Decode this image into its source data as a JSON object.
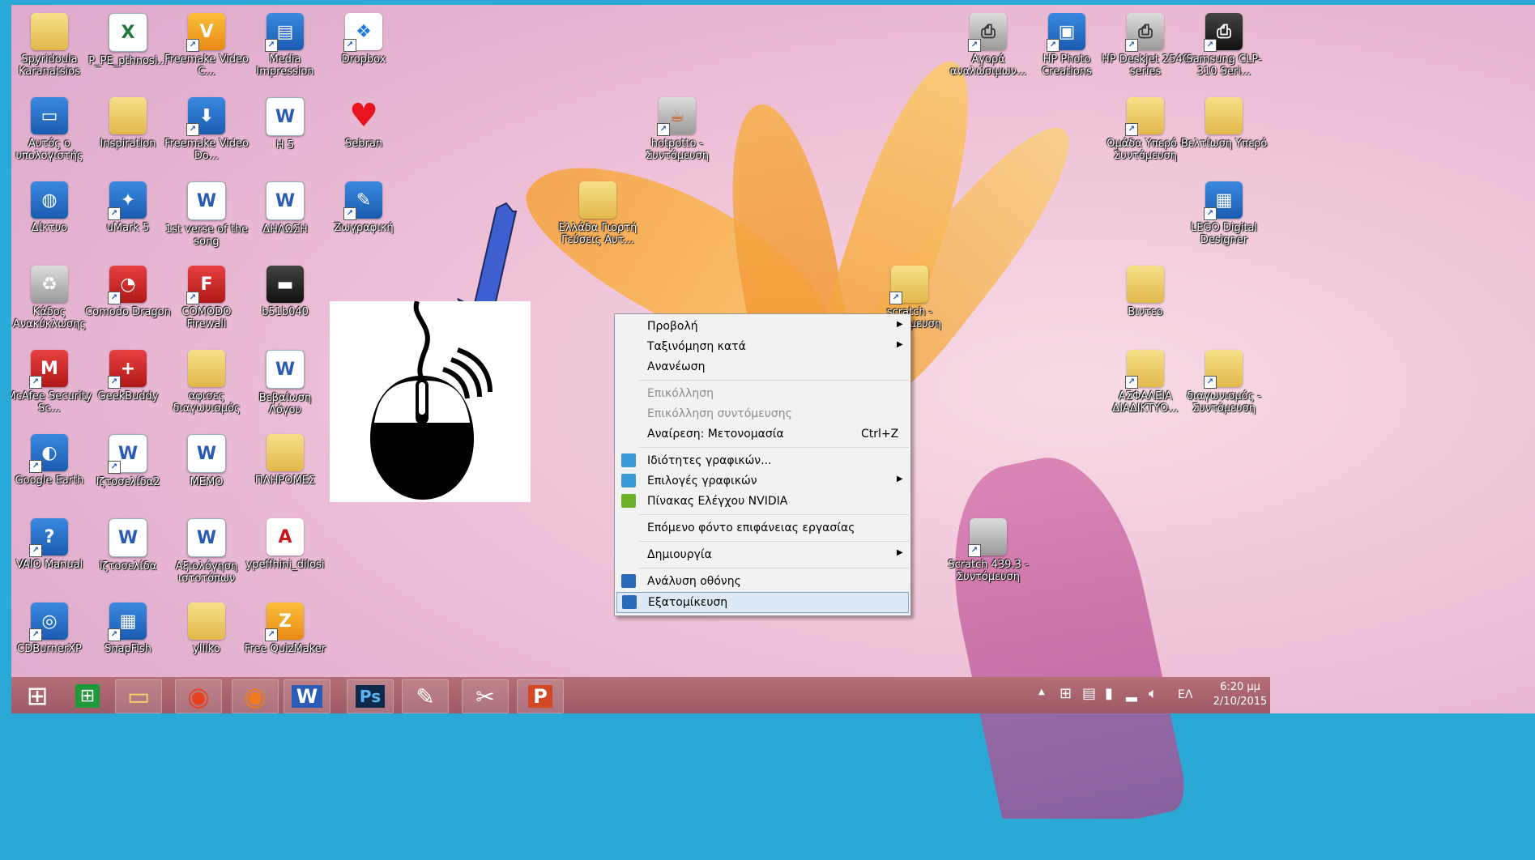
{
  "desktop_icons": [
    {
      "label": "Spyridoula Karanatsios"
    },
    {
      "label": "P_PE_pthnosi..."
    },
    {
      "label": "Freemake Video C..."
    },
    {
      "label": "Media Impression"
    },
    {
      "label": "Dropbox"
    },
    {
      "label": "Αυτός ο υπολογιστής"
    },
    {
      "label": "Inspiration"
    },
    {
      "label": "Freemake Video Do..."
    },
    {
      "label": "H 5"
    },
    {
      "label": "Sebran"
    },
    {
      "label": "Δίκτυο"
    },
    {
      "label": "uMark 5"
    },
    {
      "label": "1st verse of the song"
    },
    {
      "label": "ΔΗΛΩΣΗ"
    },
    {
      "label": "Ζωγραφική"
    },
    {
      "label": "Κάδος Ανακύκλωσης"
    },
    {
      "label": "Comodo Dragon"
    },
    {
      "label": "COMODO Firewall"
    },
    {
      "label": "b51b040"
    },
    {
      "label": "McAfee Security Sc..."
    },
    {
      "label": "GeekBuddy"
    },
    {
      "label": "αφισες διαγωνισμός"
    },
    {
      "label": "Βεβαίωση Λόγου"
    },
    {
      "label": "Google Earth"
    },
    {
      "label": "Ιζτοσελίδα2"
    },
    {
      "label": "MEMO"
    },
    {
      "label": "ΠΛΗΡΟΜΕΣ"
    },
    {
      "label": "VAIO Manual"
    },
    {
      "label": "Ιζτοσελίδα"
    },
    {
      "label": "Αξιολόγηση ιστοτόπων"
    },
    {
      "label": "ypeffhini_dilosi"
    },
    {
      "label": "CDBurnerXP"
    },
    {
      "label": "SnapFish"
    },
    {
      "label": "ylliko"
    },
    {
      "label": "Free QuizMaker"
    },
    {
      "label": "hotpotto - Συντόμευση"
    },
    {
      "label": "Ελλάδα Γιορτή Γεύσεις Αυτ..."
    },
    {
      "label": "scratch - Συντόμευση"
    },
    {
      "label": "Scratch 439.3 - Συντόμευση"
    },
    {
      "label": "Αγορά αναλώσιμων..."
    },
    {
      "label": "HP Photo Creations"
    },
    {
      "label": "HP Deskjet 2540 series"
    },
    {
      "label": "Samsung CLP-310 Seri..."
    },
    {
      "label": "Ομάδα Υπερό - Συντόμευση"
    },
    {
      "label": "Βελτίωση Υπερό"
    },
    {
      "label": "LEGO Digital Designer"
    },
    {
      "label": "Βιντεο"
    },
    {
      "label": "ΑΣΦΑΛΕΙΑ ΔΙΑΔΙΚΤΥΟ..."
    },
    {
      "label": "διαγωνισμός - Συντόμευση"
    }
  ],
  "context_menu": {
    "items": [
      {
        "label": "Προβολή",
        "arrow": "▶"
      },
      {
        "label": "Ταξινόμηση κατά",
        "arrow": "▶"
      },
      {
        "label": "Ανανέωση"
      },
      {
        "label": "Επικόλληση"
      },
      {
        "label": "Επικόλληση συντόμευσης"
      },
      {
        "label": "Αναίρεση: Μετονομασία",
        "shortcut": "Ctrl+Z"
      },
      {
        "label": "Ιδιότητες γραφικών..."
      },
      {
        "label": "Επιλογές γραφικών",
        "arrow": "▶"
      },
      {
        "label": "Πίνακας Ελέγχου NVIDIA"
      },
      {
        "label": "Επόμενο φόντο επιφάνειας εργασίας"
      },
      {
        "label": "Δημιουργία",
        "arrow": "▶"
      },
      {
        "label": "Ανάλυση οθόνης"
      },
      {
        "label": "Εξατομίκευση"
      }
    ]
  },
  "taskbar": {
    "apps": [
      {
        "name": "start",
        "glyph": "⊞"
      },
      {
        "name": "store",
        "glyph": "⊞"
      },
      {
        "name": "file-explorer",
        "glyph": "▭"
      },
      {
        "name": "chrome",
        "glyph": "◉"
      },
      {
        "name": "firefox",
        "glyph": "◉"
      },
      {
        "name": "word",
        "glyph": "W"
      },
      {
        "name": "photoshop",
        "glyph": "Ps"
      },
      {
        "name": "paint",
        "glyph": "✎"
      },
      {
        "name": "snipping",
        "glyph": "✂"
      },
      {
        "name": "powerpoint",
        "glyph": "P"
      }
    ],
    "tray": {
      "language": "ΕΛ",
      "time": "6:20 μμ",
      "date": "2/10/2015",
      "chevron": "▲"
    }
  },
  "colors": {
    "frame": "#2aa9d6",
    "menu_bg": "#f2f2f2",
    "menu_selected": "#dde9f6",
    "arrow_blue": "#3d5fd0"
  }
}
